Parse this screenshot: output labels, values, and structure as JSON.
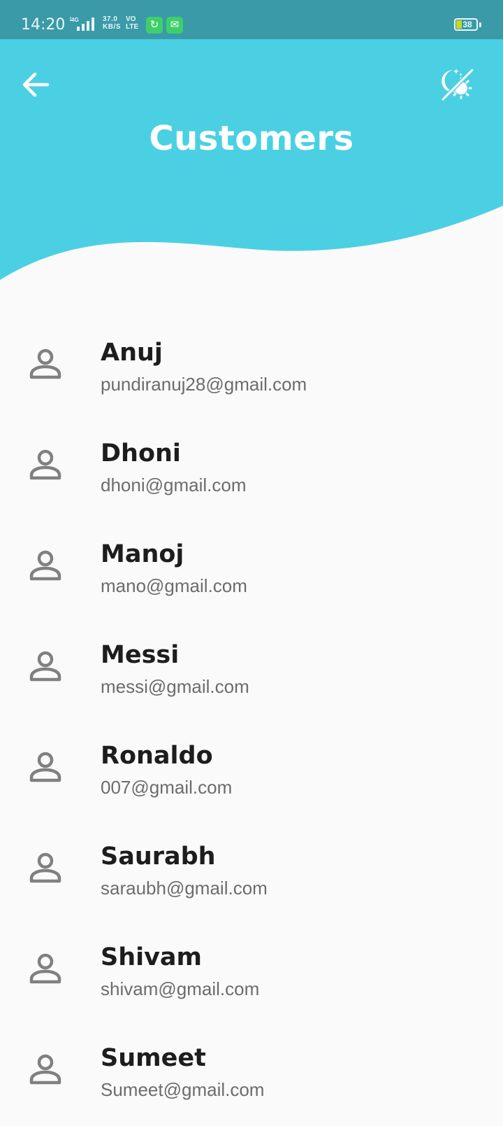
{
  "status_bar": {
    "time": "14:20",
    "network": "4G",
    "speed_value": "37.0",
    "speed_unit": "KB/S",
    "volte_top": "VO",
    "volte_bottom": "LTE",
    "battery_level": "38"
  },
  "header": {
    "title": "Customers",
    "back_icon": "arrow-left-icon",
    "theme_icon": "theme-toggle-icon",
    "background_color": "#4bd0e3"
  },
  "customers": [
    {
      "name": "Anuj",
      "email": "pundiranuj28@gmail.com"
    },
    {
      "name": "Dhoni",
      "email": "dhoni@gmail.com"
    },
    {
      "name": "Manoj",
      "email": "mano@gmail.com"
    },
    {
      "name": "Messi",
      "email": "messi@gmail.com"
    },
    {
      "name": "Ronaldo",
      "email": "007@gmail.com"
    },
    {
      "name": "Saurabh",
      "email": "saraubh@gmail.com"
    },
    {
      "name": "Shivam",
      "email": "shivam@gmail.com"
    },
    {
      "name": "Sumeet",
      "email": "Sumeet@gmail.com"
    }
  ]
}
